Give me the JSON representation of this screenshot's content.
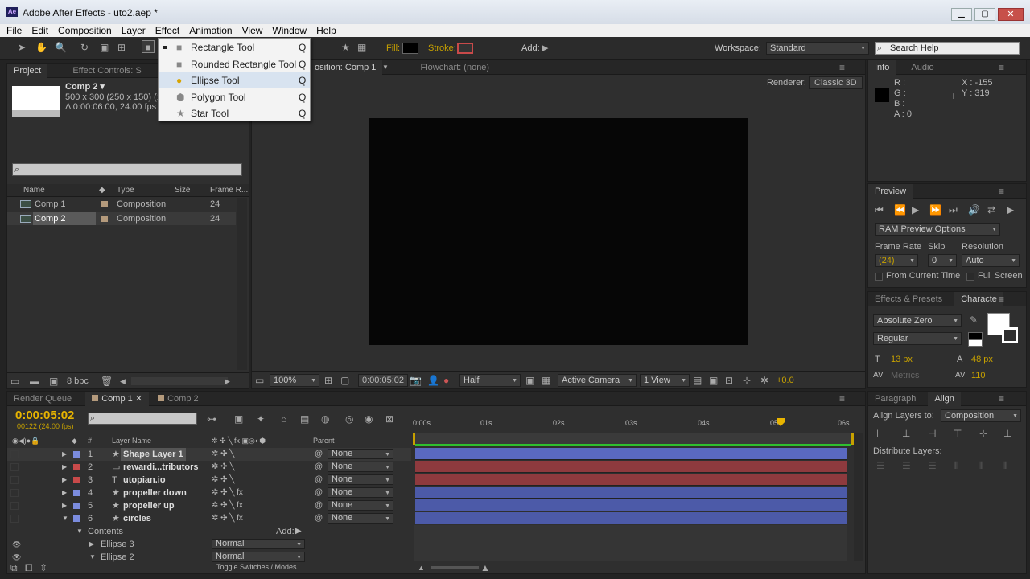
{
  "app": {
    "title": "Adobe After Effects - uto2.aep *",
    "badge": "Ae"
  },
  "menu": [
    "File",
    "Edit",
    "Composition",
    "Layer",
    "Effect",
    "Animation",
    "View",
    "Window",
    "Help"
  ],
  "toolbar": {
    "fill_label": "Fill:",
    "stroke_label": "Stroke:",
    "add_label": "Add:",
    "workspace_label": "Workspace:",
    "workspace_value": "Standard",
    "search_help": "Search Help"
  },
  "shape_menu": [
    {
      "label": "Rectangle Tool",
      "shortcut": "Q",
      "icon": "rectangle-icon"
    },
    {
      "label": "Rounded Rectangle Tool",
      "shortcut": "Q",
      "icon": "rounded-rectangle-icon"
    },
    {
      "label": "Ellipse Tool",
      "shortcut": "Q",
      "icon": "ellipse-icon"
    },
    {
      "label": "Polygon Tool",
      "shortcut": "Q",
      "icon": "polygon-icon"
    },
    {
      "label": "Star Tool",
      "shortcut": "Q",
      "icon": "star-icon"
    }
  ],
  "project": {
    "tabs": [
      "Project",
      "Effect Controls: S"
    ],
    "comp_name": "Comp 2 ▾",
    "comp_info1": "500 x 300  (250 x 150) (1",
    "comp_info2": "Δ 0:00:06:00, 24.00 fps",
    "columns": [
      "Name",
      "Type",
      "Size",
      "Frame R..."
    ],
    "items": [
      {
        "name": "Comp 1",
        "type": "Composition",
        "frame_rate": "24"
      },
      {
        "name": "Comp 2",
        "type": "Composition",
        "frame_rate": "24"
      }
    ],
    "bpc": "8 bpc"
  },
  "viewer": {
    "tabs": [
      "osition: Comp 1",
      "Flowchart: (none)"
    ],
    "renderer_label": "Renderer:",
    "renderer_value": "Classic 3D",
    "zoom": "100%",
    "timecode": "0:00:05:02",
    "resolution": "Half",
    "camera": "Active Camera",
    "views": "1 View",
    "exposure": "+0.0"
  },
  "info": {
    "tabs": [
      "Info",
      "Audio"
    ],
    "r": "R :",
    "g": "G :",
    "b": "B :",
    "a": "A : 0",
    "x": "X : -155",
    "y": "Y : 319"
  },
  "preview": {
    "tab": "Preview",
    "ram": "RAM Preview Options",
    "frame_rate_label": "Frame Rate",
    "skip_label": "Skip",
    "resolution_label": "Resolution",
    "frame_rate": "(24)",
    "skip": "0",
    "resolution": "Auto",
    "from_current": "From Current Time",
    "full_screen": "Full Screen"
  },
  "character": {
    "tabs": [
      "Effects & Presets",
      "Characte"
    ],
    "font": "Absolute Zero",
    "style": "Regular",
    "size": "13 px",
    "leading": "48 px",
    "kerning": "Metrics",
    "tracking": "110"
  },
  "align": {
    "tabs": [
      "Paragraph",
      "Align"
    ],
    "align_to_label": "Align Layers to:",
    "align_to_value": "Composition",
    "distribute_label": "Distribute Layers:"
  },
  "timeline": {
    "tabs": [
      "Render Queue",
      "Comp 1",
      "Comp 2"
    ],
    "timecode": "0:00:05:02",
    "frame_info": "00122 (24.00 fps)",
    "layer_name_header": "Layer Name",
    "parent_header": "Parent",
    "ruler": [
      "0:00s",
      "01s",
      "02s",
      "03s",
      "04s",
      "05s",
      "06s"
    ],
    "layers": [
      {
        "num": "1",
        "name": "Shape Layer 1",
        "color": "#7b8cde",
        "bar": "#5a69c0",
        "type": "star",
        "parent": "None"
      },
      {
        "num": "2",
        "name": "rewardi...tributors",
        "color": "#c94a4a",
        "bar": "#8e3a3e",
        "type": "image",
        "parent": "None"
      },
      {
        "num": "3",
        "name": "utopian.io",
        "color": "#c94a4a",
        "bar": "#8e3a3e",
        "type": "text",
        "parent": "None"
      },
      {
        "num": "4",
        "name": "propeller down",
        "color": "#7b8cde",
        "bar": "#4c5aa8",
        "type": "star",
        "parent": "None"
      },
      {
        "num": "5",
        "name": "propeller up",
        "color": "#7b8cde",
        "bar": "#4c5aa8",
        "type": "star",
        "parent": "None"
      },
      {
        "num": "6",
        "name": "circles",
        "color": "#7b8cde",
        "bar": "#4c5aa8",
        "type": "star",
        "parent": "None"
      }
    ],
    "contents_label": "Contents",
    "add_label": "Add:",
    "sublayers": [
      {
        "name": "Ellipse 3",
        "mode": "Normal"
      },
      {
        "name": "Ellipse 2",
        "mode": "Normal"
      }
    ],
    "toggle_label": "Toggle Switches / Modes",
    "playhead_fraction": 0.8472
  }
}
